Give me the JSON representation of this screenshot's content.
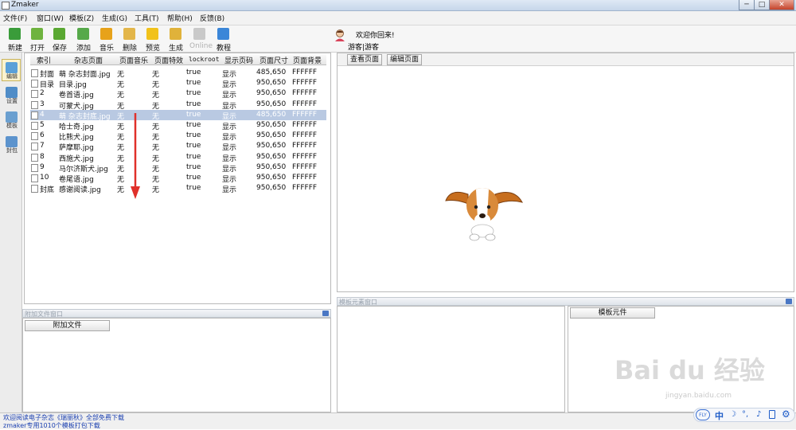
{
  "window": {
    "title": "Zmaker",
    "minimize": "─",
    "maximize": "□",
    "close": "✕"
  },
  "menu": [
    "文件(F)",
    "窗口(W)",
    "模板(Z)",
    "生成(G)",
    "工具(T)",
    "帮助(H)",
    "反馈(B)"
  ],
  "toolbar": [
    {
      "label": "新建",
      "icon": "new-icon",
      "color": "#3a9c3a",
      "enabled": true
    },
    {
      "label": "打开",
      "icon": "open-icon",
      "color": "#6fb33f",
      "enabled": true
    },
    {
      "label": "保存",
      "icon": "save-icon",
      "color": "#5aa832",
      "enabled": true
    },
    {
      "label": "添加",
      "icon": "add-icon",
      "color": "#56a94a",
      "enabled": true
    },
    {
      "label": "音乐",
      "icon": "music-icon",
      "color": "#e7a21a",
      "enabled": true
    },
    {
      "label": "删除",
      "icon": "delete-icon",
      "color": "#e3b64a",
      "enabled": true
    },
    {
      "label": "预览",
      "icon": "preview-star-icon",
      "color": "#f1c21b",
      "enabled": true
    },
    {
      "label": "生成",
      "icon": "generate-icon",
      "color": "#e0b23a",
      "enabled": true
    },
    {
      "label": "Online",
      "icon": "online-icon",
      "color": "#c9c9c9",
      "enabled": false
    },
    {
      "label": "教程",
      "icon": "help-icon",
      "color": "#3b86d8",
      "enabled": true
    }
  ],
  "user": {
    "greeting": "欢迎你回来!",
    "name": "游客|游客"
  },
  "side_tabs": [
    {
      "label": "编辑",
      "icon": "edit-icon",
      "active": true
    },
    {
      "label": "设置",
      "icon": "settings-icon",
      "active": false
    },
    {
      "label": "模板",
      "icon": "template-icon",
      "active": false
    },
    {
      "label": "封包",
      "icon": "package-icon",
      "active": false
    }
  ],
  "table": {
    "headers": [
      "索引",
      "杂志页面",
      "页面音乐",
      "页面特效",
      "lockroot",
      "显示页码",
      "页面尺寸",
      "页面背景"
    ],
    "rows": [
      {
        "index": "封面",
        "page": "萌 杂志封面.jpg",
        "music": "无",
        "effect": "无",
        "lockroot": "true",
        "showpage": "显示",
        "size": "485,650",
        "bg": "FFFFFF",
        "selected": false
      },
      {
        "index": "目录",
        "page": "目录.jpg",
        "music": "无",
        "effect": "无",
        "lockroot": "true",
        "showpage": "显示",
        "size": "950,650",
        "bg": "FFFFFF",
        "selected": false
      },
      {
        "index": "2",
        "page": "卷首语.jpg",
        "music": "无",
        "effect": "无",
        "lockroot": "true",
        "showpage": "显示",
        "size": "950,650",
        "bg": "FFFFFF",
        "selected": false
      },
      {
        "index": "3",
        "page": "可蒙犬.jpg",
        "music": "无",
        "effect": "无",
        "lockroot": "true",
        "showpage": "显示",
        "size": "950,650",
        "bg": "FFFFFF",
        "selected": false
      },
      {
        "index": "4",
        "page": "萌 杂志封底.jpg",
        "music": "无",
        "effect": "无",
        "lockroot": "true",
        "showpage": "显示",
        "size": "485,650",
        "bg": "FFFFFF",
        "selected": true
      },
      {
        "index": "5",
        "page": "哈士奇.jpg",
        "music": "无",
        "effect": "无",
        "lockroot": "true",
        "showpage": "显示",
        "size": "950,650",
        "bg": "FFFFFF",
        "selected": false
      },
      {
        "index": "6",
        "page": "比熊犬.jpg",
        "music": "无",
        "effect": "无",
        "lockroot": "true",
        "showpage": "显示",
        "size": "950,650",
        "bg": "FFFFFF",
        "selected": false
      },
      {
        "index": "7",
        "page": "萨摩耶.jpg",
        "music": "无",
        "effect": "无",
        "lockroot": "true",
        "showpage": "显示",
        "size": "950,650",
        "bg": "FFFFFF",
        "selected": false
      },
      {
        "index": "8",
        "page": "西施犬.jpg",
        "music": "无",
        "effect": "无",
        "lockroot": "true",
        "showpage": "显示",
        "size": "950,650",
        "bg": "FFFFFF",
        "selected": false
      },
      {
        "index": "9",
        "page": "马尔济斯犬.jpg",
        "music": "无",
        "effect": "无",
        "lockroot": "true",
        "showpage": "显示",
        "size": "950,650",
        "bg": "FFFFFF",
        "selected": false
      },
      {
        "index": "10",
        "page": "卷尾语.jpg",
        "music": "无",
        "effect": "无",
        "lockroot": "true",
        "showpage": "显示",
        "size": "950,650",
        "bg": "FFFFFF",
        "selected": false
      },
      {
        "index": "封底",
        "page": "感谢阅读.jpg",
        "music": "无",
        "effect": "无",
        "lockroot": "true",
        "showpage": "显示",
        "size": "950,650",
        "bg": "FFFFFF",
        "selected": false
      }
    ]
  },
  "preview": {
    "view_button": "查看页面",
    "edit_button": "编辑页面"
  },
  "attach": {
    "window_title": "附加文件窗口",
    "column": "附加文件"
  },
  "template_elements": {
    "window_title": "模板元素窗口",
    "column": "模板元件"
  },
  "status": {
    "line1": "欢迎阅读电子杂志《瑞丽秋》全部免费下载",
    "line2": "zmaker专用1010个模板打包下载"
  },
  "ime": {
    "badge": "FLY",
    "mode": "中"
  },
  "watermark": {
    "brand": "Bai du 经验",
    "url": "jingyan.baidu.com"
  }
}
